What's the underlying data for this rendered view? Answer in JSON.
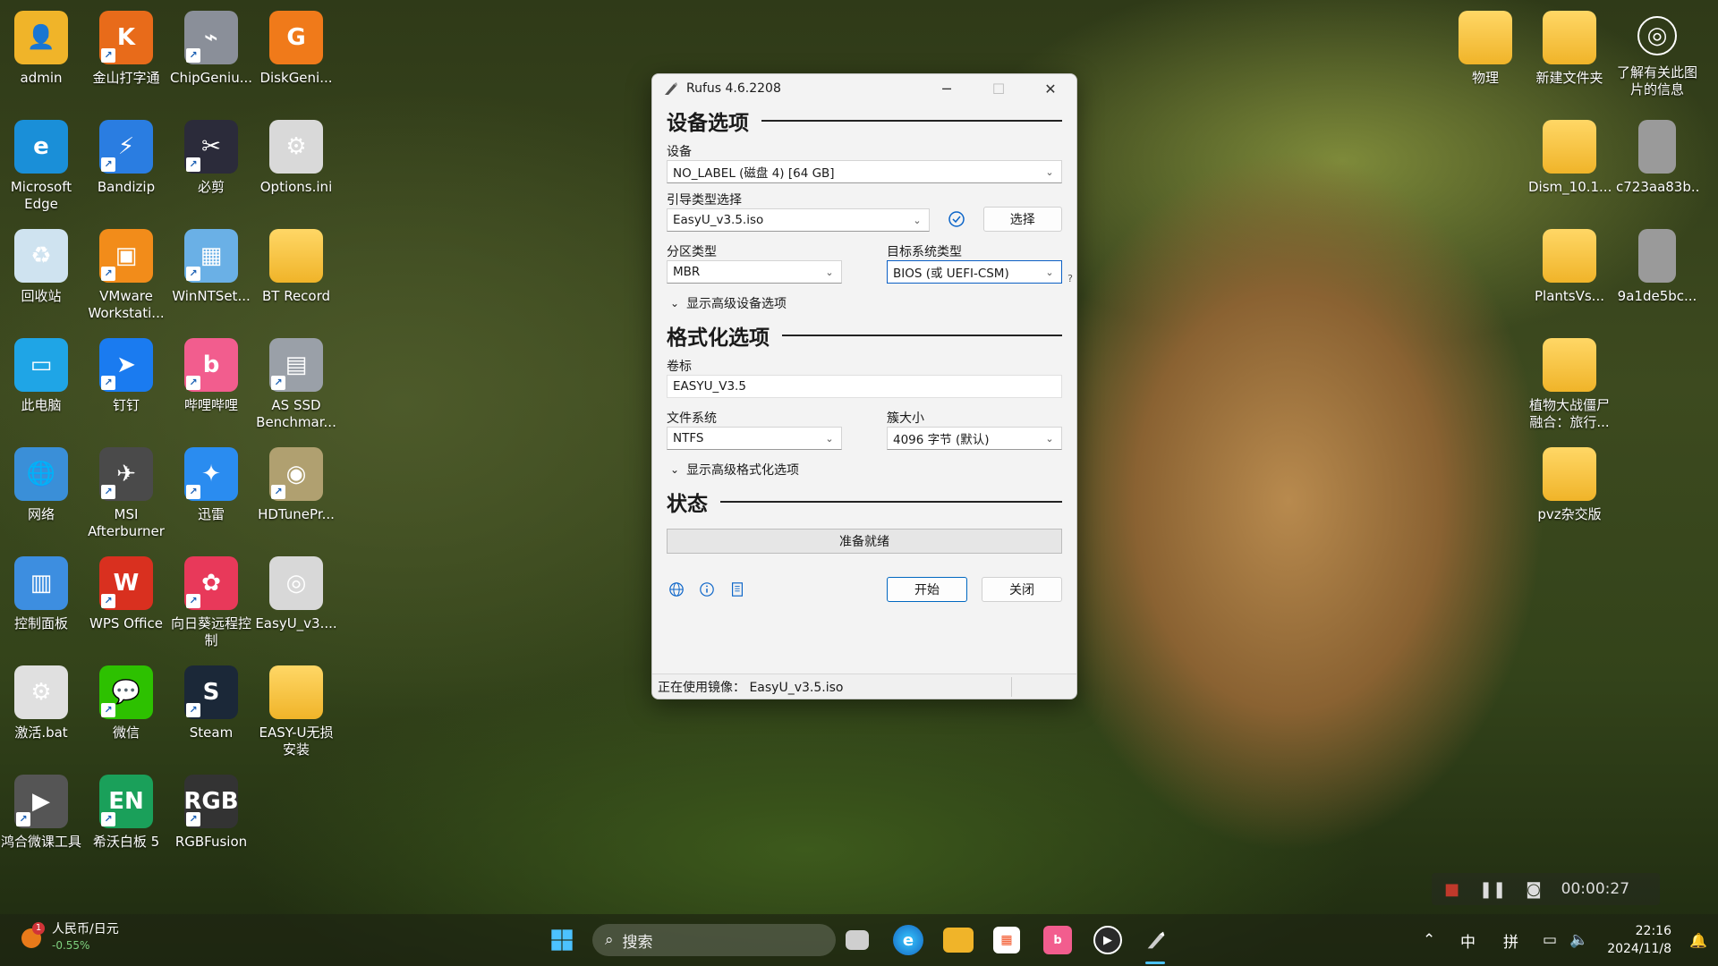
{
  "desktop": {
    "left_icons": [
      {
        "label": "admin",
        "glyph": "👤",
        "color": "#f0b429",
        "shortcut": false
      },
      {
        "label": "金山打字通",
        "glyph": "K",
        "color": "#e86b1a",
        "shortcut": true
      },
      {
        "label": "ChipGeniu...",
        "glyph": "⌁",
        "color": "#8a8f99",
        "shortcut": true
      },
      {
        "label": "DiskGeni...",
        "glyph": "G",
        "color": "#f07a1a",
        "shortcut": false
      },
      {
        "label": "Microsoft Edge",
        "glyph": "e",
        "color": "#1a8fd8",
        "shortcut": false
      },
      {
        "label": "Bandizip",
        "glyph": "⚡",
        "color": "#2a7de1",
        "shortcut": true
      },
      {
        "label": "必剪",
        "glyph": "✂",
        "color": "#2b2b3a",
        "shortcut": true
      },
      {
        "label": "Options.ini",
        "glyph": "⚙",
        "color": "#d9d9d9",
        "shortcut": false
      },
      {
        "label": "回收站",
        "glyph": "♻",
        "color": "#cfe3f0",
        "shortcut": false
      },
      {
        "label": "VMware Workstati...",
        "glyph": "▣",
        "color": "#f28c1a",
        "shortcut": true
      },
      {
        "label": "WinNTSet...",
        "glyph": "▦",
        "color": "#6ab0e6",
        "shortcut": true
      },
      {
        "label": "BT Record",
        "glyph": "",
        "color": "#f0b429",
        "shortcut": false
      },
      {
        "label": "此电脑",
        "glyph": "▭",
        "color": "#1fa5e6",
        "shortcut": false
      },
      {
        "label": "钉钉",
        "glyph": "➤",
        "color": "#1a7bf0",
        "shortcut": true
      },
      {
        "label": "哔哩哔哩",
        "glyph": "b",
        "color": "#f25d8e",
        "shortcut": true
      },
      {
        "label": "AS SSD Benchmar...",
        "glyph": "▤",
        "color": "#9aa0a8",
        "shortcut": true
      },
      {
        "label": "网络",
        "glyph": "🌐",
        "color": "#3a8fd8",
        "shortcut": false
      },
      {
        "label": "MSI Afterburner",
        "glyph": "✈",
        "color": "#4a4a4a",
        "shortcut": true
      },
      {
        "label": "迅雷",
        "glyph": "✦",
        "color": "#2a8cf0",
        "shortcut": true
      },
      {
        "label": "HDTunePr...",
        "glyph": "◉",
        "color": "#b0a070",
        "shortcut": true
      },
      {
        "label": "控制面板",
        "glyph": "▥",
        "color": "#3d8ee0",
        "shortcut": false
      },
      {
        "label": "WPS Office",
        "glyph": "W",
        "color": "#d9301f",
        "shortcut": true
      },
      {
        "label": "向日葵远程控制",
        "glyph": "✿",
        "color": "#e8395a",
        "shortcut": true
      },
      {
        "label": "EasyU_v3....",
        "glyph": "◎",
        "color": "#d8d8d8",
        "shortcut": false
      },
      {
        "label": "激活.bat",
        "glyph": "⚙",
        "color": "#e0e0e0",
        "shortcut": false
      },
      {
        "label": "微信",
        "glyph": "💬",
        "color": "#2dc100",
        "shortcut": true
      },
      {
        "label": "Steam",
        "glyph": "S",
        "color": "#1b2838",
        "shortcut": true
      },
      {
        "label": "EASY-U无损安装",
        "glyph": "",
        "color": "#f0b429",
        "shortcut": false
      },
      {
        "label": "鸿合微课工具",
        "glyph": "▶",
        "color": "#555",
        "shortcut": true
      },
      {
        "label": "希沃白板 5",
        "glyph": "EN",
        "color": "#1aa05a",
        "shortcut": true
      },
      {
        "label": "RGBFusion",
        "glyph": "RGB",
        "color": "#333",
        "shortcut": true
      }
    ],
    "right_icons": [
      {
        "label": "物理",
        "glyph": "",
        "color": "#f0b429"
      },
      {
        "label": "新建文件夹",
        "glyph": "",
        "color": "#f0b429"
      },
      {
        "label": "了解有关此图片的信息",
        "glyph": "◎",
        "color": "rgba(0,0,0,0)"
      },
      {
        "label": "Dism_10.1...",
        "glyph": "",
        "color": "#f0b429"
      },
      {
        "label": "c723aa83b...",
        "glyph": "",
        "color": "#9a9a9a"
      },
      {
        "label": "PlantsVs...",
        "glyph": "",
        "color": "#f0b429"
      },
      {
        "label": "9a1de5bc...",
        "glyph": "",
        "color": "#9a9a9a"
      },
      {
        "label": "植物大战僵尸融合：旅行...",
        "glyph": "",
        "color": "#f0b429"
      },
      {
        "label": "pvz杂交版",
        "glyph": "",
        "color": "#f0b429"
      }
    ]
  },
  "rufus": {
    "title": "Rufus 4.6.2208",
    "device_section": "设备选项",
    "device_label": "设备",
    "device_value": "NO_LABEL (磁盘 4) [64 GB]",
    "boot_label": "引导类型选择",
    "boot_value": "EasyU_v3.5.iso",
    "select_button": "选择",
    "partition_label": "分区类型",
    "partition_value": "MBR",
    "target_label": "目标系统类型",
    "target_value": "BIOS (或 UEFI-CSM)",
    "help_mark": "?",
    "adv_device": "显示高级设备选项",
    "format_section": "格式化选项",
    "volume_label": "卷标",
    "volume_value": "EASYU_V3.5",
    "fs_label": "文件系统",
    "fs_value": "NTFS",
    "cluster_label": "簇大小",
    "cluster_value": "4096 字节 (默认)",
    "adv_format": "显示高级格式化选项",
    "status_section": "状态",
    "status_text": "准备就绪",
    "start_button": "开始",
    "close_button": "关闭",
    "footer_text": "正在使用镜像： EasyU_v3.5.iso"
  },
  "recorder": {
    "time": "00:00:27"
  },
  "taskbar": {
    "weather_title": "人民币/日元",
    "weather_change": "-0.55%",
    "weather_badge": "1",
    "search_placeholder": "搜索",
    "ime_lang": "中",
    "ime_mode": "拼",
    "time": "22:16",
    "date": "2024/11/8"
  }
}
